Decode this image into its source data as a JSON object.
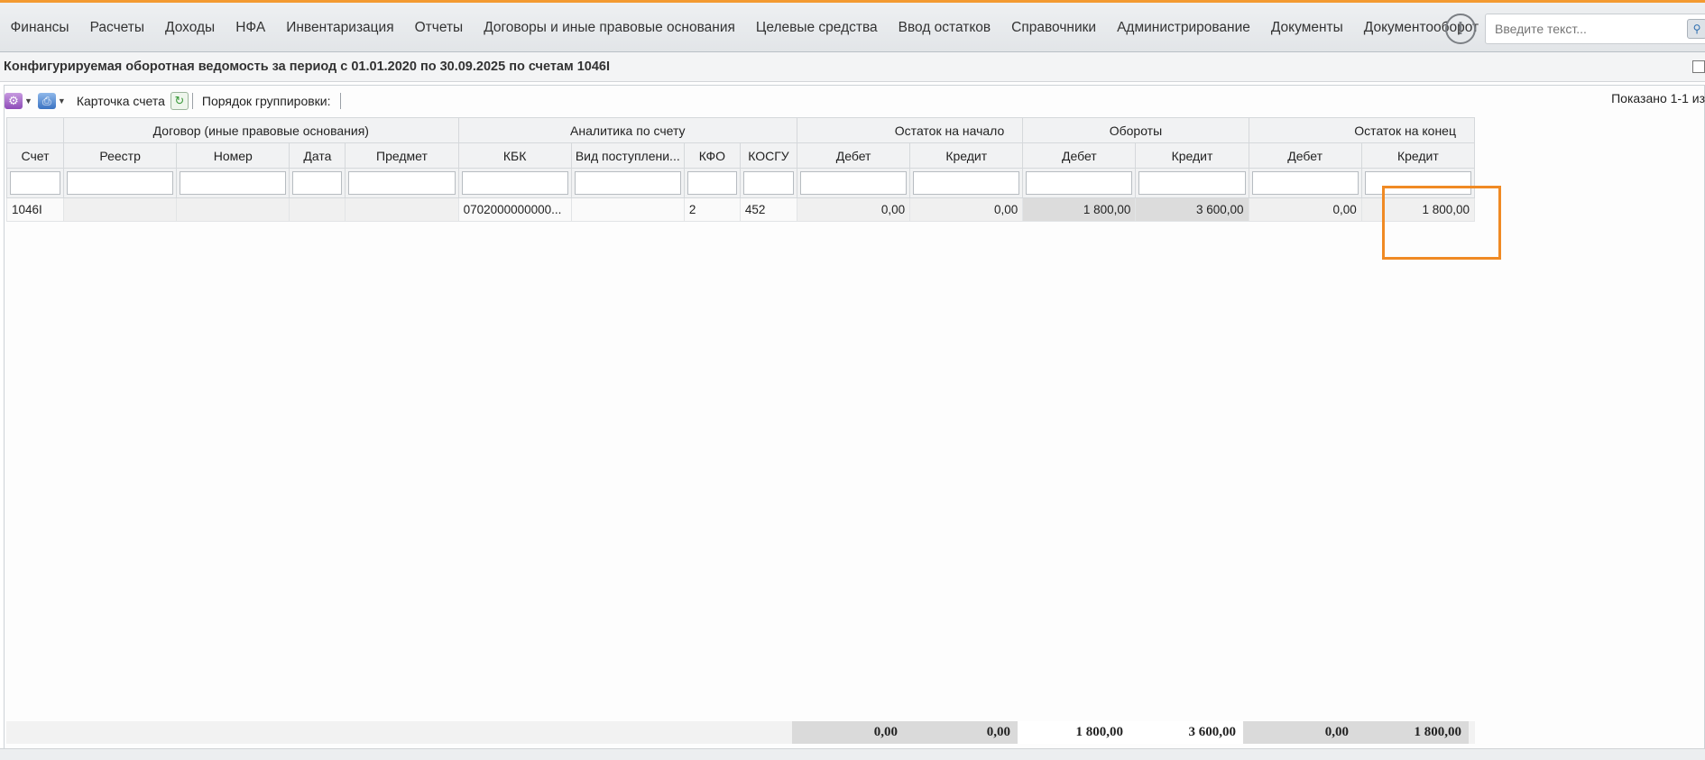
{
  "menu": [
    "Финансы",
    "Расчеты",
    "Доходы",
    "НФА",
    "Инвентаризация",
    "Отчеты",
    "Договоры и иные правовые основания",
    "Целевые средства",
    "Ввод остатков",
    "Справочники",
    "Администрирование",
    "Документы",
    "Документооборот"
  ],
  "alert_icon": "!",
  "search": {
    "placeholder": "Введите текст..."
  },
  "page_title": "Конфигурируемая оборотная ведомость за период с 01.01.2020 по 30.09.2025 по счетам 1046I",
  "toolbar": {
    "account_card": "Карточка счета",
    "grouping_order": "Порядок группировки:",
    "shown": "Показано 1-1 из"
  },
  "groups": {
    "contract": "Договор (иные правовые основания)",
    "analytics": "Аналитика по счету",
    "opening": "Остаток на начало",
    "turnover": "Обороты",
    "closing": "Остаток на конец"
  },
  "columns": [
    "Счет",
    "Реестр",
    "Номер",
    "Дата",
    "Предмет",
    "КБК",
    "Вид поступлени...",
    "КФО",
    "КОСГУ",
    "Дебет",
    "Кредит",
    "Дебет",
    "Кредит",
    "Дебет",
    "Кредит"
  ],
  "rows": [
    [
      "1046I",
      "",
      "",
      "",
      "",
      "0702000000000...",
      "",
      "2",
      "452",
      "0,00",
      "0,00",
      "1 800,00",
      "3 600,00",
      "0,00",
      "1 800,00"
    ]
  ],
  "totals": [
    "0,00",
    "0,00",
    "1 800,00",
    "3 600,00",
    "0,00",
    "1 800,00"
  ]
}
